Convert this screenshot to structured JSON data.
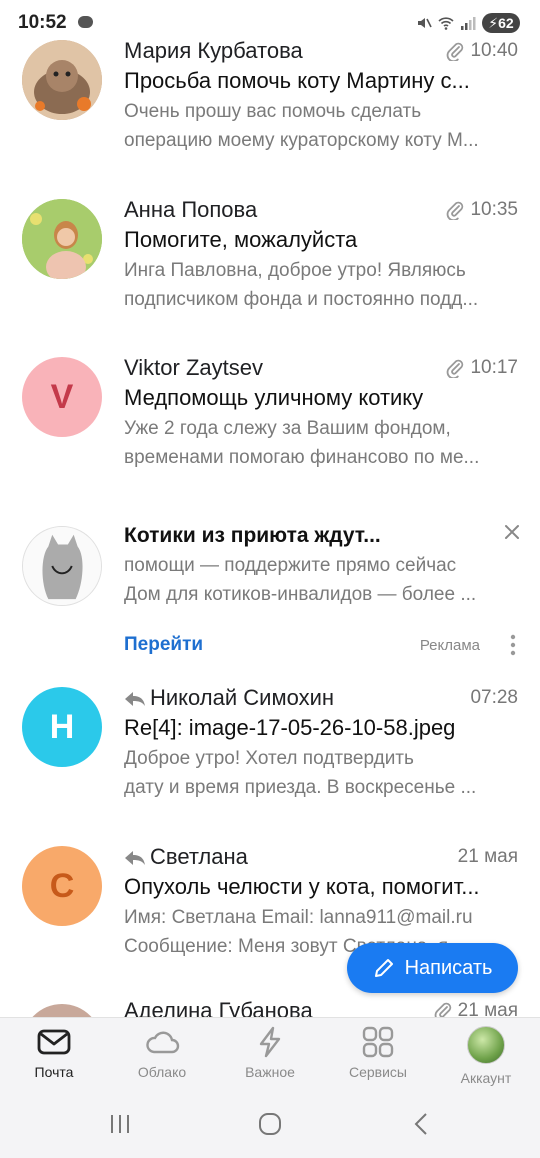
{
  "status": {
    "time": "10:52",
    "battery": "62"
  },
  "emails": [
    {
      "sender": "Мария Курбатова",
      "time": "10:40",
      "subject": "Просьба помочь коту Мартину с...",
      "preview1": "Очень прошу вас помочь сделать",
      "preview2": "операцию моему кураторскому коту М...",
      "attachment": true
    },
    {
      "sender": "Анна Попова",
      "time": "10:35",
      "subject": "Помогите, можалуйста",
      "preview1": "Инга Павловна, доброе утро! Являюсь",
      "preview2": "подписчиком фонда и постоянно подд...",
      "attachment": true
    },
    {
      "sender": "Viktor Zaytsev",
      "avatar_letter": "V",
      "time": "10:17",
      "subject": "Медпомощь уличному котику",
      "preview1": "Уже 2 года слежу за Вашим фондом,",
      "preview2": "временами помогаю финансово по ме...",
      "attachment": true
    },
    {
      "sender": "Николай Симохин",
      "avatar_letter": "Н",
      "time": "07:28",
      "subject": "Re[4]: image-17-05-26-10-58.jpeg",
      "preview1": "Доброе утро! Хотел подтвердить",
      "preview2": "дату и время приезда. В воскресенье ...",
      "replied": true
    },
    {
      "sender": "Светлана",
      "avatar_letter": "С",
      "time": "21 мая",
      "subject": "Опухоль челюсти у кота, помогит...",
      "preview1": "Имя: Светлана Email: lanna911@mail.ru",
      "preview2": "Сообщение: Меня зовут Светлана, я ...",
      "replied": true
    },
    {
      "sender": "Аделина Губанова",
      "time": "21 мая",
      "attachment": true
    }
  ],
  "ad": {
    "title": "Котики из приюта ждут...",
    "line1": "помощи — поддержите прямо сейчас",
    "line2": "Дом для котиков-инвалидов — более ...",
    "go": "Перейти",
    "label": "Реклама"
  },
  "compose": {
    "label": "Написать"
  },
  "bottom_nav": [
    {
      "label": "Почта",
      "icon": "mail-icon",
      "active": true
    },
    {
      "label": "Облако",
      "icon": "cloud-icon"
    },
    {
      "label": "Важное",
      "icon": "lightning-icon"
    },
    {
      "label": "Сервисы",
      "icon": "grid-icon"
    },
    {
      "label": "Аккаунт",
      "icon": "avatar"
    }
  ],
  "colors": {
    "accent": "#1a7bf2",
    "link": "#1e6fd0",
    "avatar_v": "#f9b3b9",
    "avatar_n": "#2bc9ea",
    "avatar_s": "#f8a96a"
  }
}
